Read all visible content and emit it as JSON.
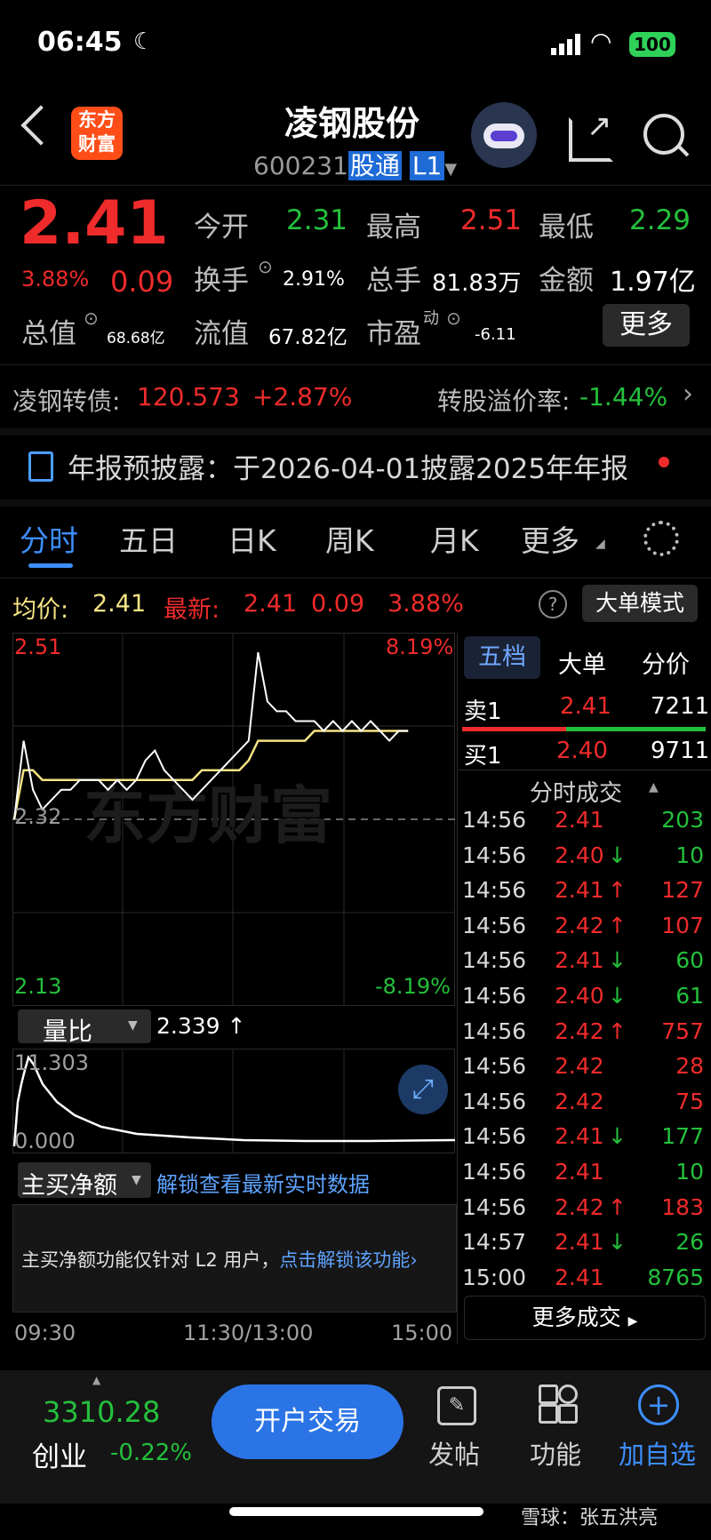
{
  "status_bar": {
    "time": "06:45",
    "battery": "100"
  },
  "header": {
    "title": "凌钢股份",
    "code": "600231",
    "tag_gt": "股通",
    "tag_level": "L1",
    "logo_line1": "东方",
    "logo_line2": "财富"
  },
  "quote": {
    "price": "2.41",
    "change_pct": "3.88%",
    "change": "0.09",
    "open_label": "今开",
    "open": "2.31",
    "high_label": "最高",
    "high": "2.51",
    "low_label": "最低",
    "low": "2.29",
    "turnover_label": "换手",
    "turnover": "2.91%",
    "volume_label": "总手",
    "volume": "81.83万",
    "amount_label": "金额",
    "amount": "1.97亿",
    "mcap_label": "总值",
    "mcap": "68.68亿",
    "float_label": "流值",
    "float": "67.82亿",
    "pe_label": "市盈",
    "pe_sup": "动",
    "pe": "-6.11",
    "more_button": "更多"
  },
  "convertible": {
    "label": "凌钢转债:",
    "price": "120.573",
    "change": "+2.87%",
    "premium_label": "转股溢价率:",
    "premium": "-1.44%"
  },
  "notice": {
    "text": "年报预披露：于2026-04-01披露2025年年报"
  },
  "chart_tabs": [
    "分时",
    "五日",
    "日K",
    "周K",
    "月K",
    "更多"
  ],
  "info_line": {
    "avg_label": "均价:",
    "avg": "2.41",
    "latest_label": "最新:",
    "latest": "2.41",
    "change": "0.09",
    "pct": "3.88%",
    "mode_button": "大单模式"
  },
  "chart": {
    "y_high": "2.51",
    "y_mid": "2.32",
    "y_low": "2.13",
    "pct_high": "8.19%",
    "pct_low": "-8.19%",
    "watermark": "东方财富",
    "time_start": "09:30",
    "time_mid": "11:30/13:00",
    "time_end": "15:00"
  },
  "chart_data": {
    "type": "line",
    "ylim": [
      2.13,
      2.51
    ],
    "grid": true,
    "series": [
      {
        "values": [
          2.32,
          2.4,
          2.35,
          2.33,
          2.34,
          2.35,
          2.35,
          2.36,
          2.36,
          2.36,
          2.35,
          2.36,
          2.35,
          2.36,
          2.38,
          2.39,
          2.37,
          2.36,
          2.35,
          2.34,
          2.35,
          2.36,
          2.37,
          2.38,
          2.39,
          2.4,
          2.49,
          2.44,
          2.43,
          2.43,
          2.42,
          2.42,
          2.42,
          2.41,
          2.42,
          2.41,
          2.42,
          2.41,
          2.42,
          2.41,
          2.4,
          2.41,
          2.41
        ]
      },
      {
        "values": [
          2.32,
          2.37,
          2.37,
          2.36,
          2.36,
          2.36,
          2.36,
          2.36,
          2.36,
          2.36,
          2.36,
          2.36,
          2.36,
          2.36,
          2.36,
          2.36,
          2.36,
          2.36,
          2.36,
          2.36,
          2.37,
          2.37,
          2.37,
          2.37,
          2.37,
          2.38,
          2.4,
          2.4,
          2.4,
          2.4,
          2.4,
          2.4,
          2.41,
          2.41,
          2.41,
          2.41,
          2.41,
          2.41,
          2.41,
          2.41,
          2.41,
          2.41,
          2.41
        ]
      }
    ]
  },
  "volume_ratio": {
    "label": "量比",
    "value": "2.339 ↑",
    "max": "11.303",
    "min": "0.000"
  },
  "net_buy": {
    "label": "主买净额",
    "unlock": "解锁查看最新实时数据",
    "desc": "主买净额功能仅针对 L2 用户，",
    "link": "点击解锁该功能"
  },
  "order_book": {
    "tabs": [
      "五档",
      "大单",
      "分价"
    ],
    "sell_label": "卖1",
    "sell_price": "2.41",
    "sell_qty": "7211",
    "buy_label": "买1",
    "buy_price": "2.40",
    "buy_qty": "9711",
    "ticks_title": "分时成交",
    "more_trades": "更多成交"
  },
  "trades": [
    {
      "time": "14:56",
      "price": "2.41",
      "arrow": "",
      "qty": "203",
      "price_color": "#ef2b2b",
      "qty_color": "#24c03c"
    },
    {
      "time": "14:56",
      "price": "2.40",
      "arrow": "↓",
      "qty": "10",
      "price_color": "#ef2b2b",
      "qty_color": "#24c03c"
    },
    {
      "time": "14:56",
      "price": "2.41",
      "arrow": "↑",
      "qty": "127",
      "price_color": "#ef2b2b",
      "qty_color": "#ef2b2b"
    },
    {
      "time": "14:56",
      "price": "2.42",
      "arrow": "↑",
      "qty": "107",
      "price_color": "#ef2b2b",
      "qty_color": "#ef2b2b"
    },
    {
      "time": "14:56",
      "price": "2.41",
      "arrow": "↓",
      "qty": "60",
      "price_color": "#ef2b2b",
      "qty_color": "#24c03c"
    },
    {
      "time": "14:56",
      "price": "2.40",
      "arrow": "↓",
      "qty": "61",
      "price_color": "#ef2b2b",
      "qty_color": "#24c03c"
    },
    {
      "time": "14:56",
      "price": "2.42",
      "arrow": "↑",
      "qty": "757",
      "price_color": "#ef2b2b",
      "qty_color": "#ef2b2b"
    },
    {
      "time": "14:56",
      "price": "2.42",
      "arrow": "",
      "qty": "28",
      "price_color": "#ef2b2b",
      "qty_color": "#ef2b2b"
    },
    {
      "time": "14:56",
      "price": "2.42",
      "arrow": "",
      "qty": "75",
      "price_color": "#ef2b2b",
      "qty_color": "#ef2b2b"
    },
    {
      "time": "14:56",
      "price": "2.41",
      "arrow": "↓",
      "qty": "177",
      "price_color": "#ef2b2b",
      "qty_color": "#24c03c"
    },
    {
      "time": "14:56",
      "price": "2.41",
      "arrow": "",
      "qty": "10",
      "price_color": "#ef2b2b",
      "qty_color": "#24c03c"
    },
    {
      "time": "14:56",
      "price": "2.42",
      "arrow": "↑",
      "qty": "183",
      "price_color": "#ef2b2b",
      "qty_color": "#ef2b2b"
    },
    {
      "time": "14:57",
      "price": "2.41",
      "arrow": "↓",
      "qty": "26",
      "price_color": "#ef2b2b",
      "qty_color": "#24c03c"
    },
    {
      "time": "15:00",
      "price": "2.41",
      "arrow": "",
      "qty": "8765",
      "price_color": "#ef2b2b",
      "qty_color": "#24c03c"
    }
  ],
  "bottom_bar": {
    "index_value": "3310.28",
    "index_name": "创业",
    "index_change": "-0.22%",
    "trade_button": "开户交易",
    "post": "发帖",
    "function": "功能",
    "add_fav": "加自选"
  },
  "footer": {
    "watermark": "雪球：张五洪亮"
  }
}
